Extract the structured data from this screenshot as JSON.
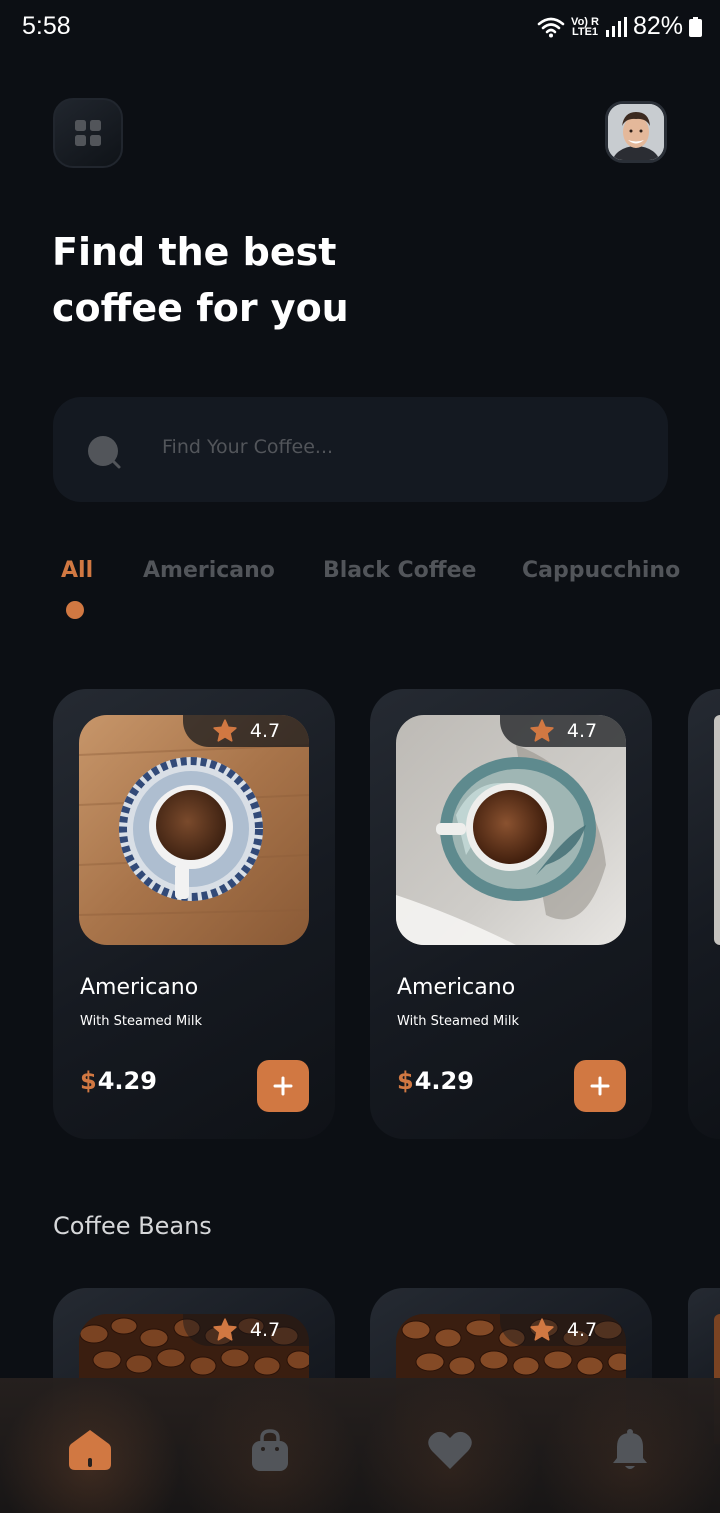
{
  "status_bar": {
    "time": "5:58",
    "network_label_top": "Vo) R",
    "network_label_bottom": "LTE1",
    "battery": "82%"
  },
  "header": {
    "title_line1": "Find the best",
    "title_line2": "coffee for you"
  },
  "search": {
    "placeholder": "Find Your Coffee..."
  },
  "tabs": [
    {
      "label": "All",
      "active": true
    },
    {
      "label": "Americano",
      "active": false
    },
    {
      "label": "Black Coffee",
      "active": false
    },
    {
      "label": "Cappucchino",
      "active": false
    }
  ],
  "coffee_cards": [
    {
      "name": "Americano",
      "subtitle": "With Steamed Milk",
      "currency": "$",
      "price": "4.29",
      "rating": "4.7"
    },
    {
      "name": "Americano",
      "subtitle": "With Steamed Milk",
      "currency": "$",
      "price": "4.29",
      "rating": "4.7"
    }
  ],
  "beans_section": {
    "title": "Coffee Beans",
    "cards": [
      {
        "rating": "4.7"
      },
      {
        "rating": "4.7"
      }
    ]
  },
  "bottom_nav": [
    {
      "icon": "home-icon",
      "active": true
    },
    {
      "icon": "bag-icon",
      "active": false
    },
    {
      "icon": "heart-icon",
      "active": false
    },
    {
      "icon": "bell-icon",
      "active": false
    }
  ],
  "colors": {
    "accent": "#d17842",
    "background": "#0c0f14",
    "card": "#1c2028",
    "muted_text": "#52555a"
  }
}
